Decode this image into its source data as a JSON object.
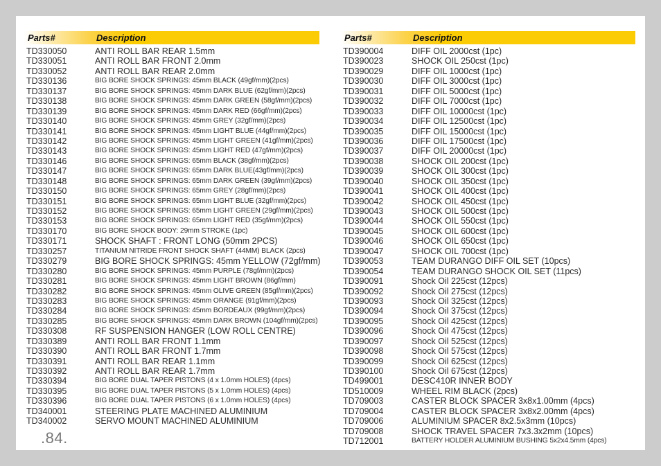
{
  "page_number": ".84.",
  "colors": {
    "header_accent": "#fbcb04",
    "background": "#cbcccb",
    "page": "#ffffff"
  },
  "left": {
    "header": {
      "parts": "Parts#",
      "description": "Description"
    },
    "rows": [
      {
        "part": "TD330050",
        "desc": "ANTI ROLL BAR REAR 1.5mm",
        "small": false
      },
      {
        "part": "TD330051",
        "desc": "ANTI ROLL BAR FRONT 2.0mm",
        "small": false
      },
      {
        "part": "TD330052",
        "desc": "ANTI ROLL BAR REAR 2.0mm",
        "small": false
      },
      {
        "part": "TD330136",
        "desc": "BIG BORE SHOCK SPRINGS: 45mm BLACK (49gf/mm)(2pcs)",
        "small": true
      },
      {
        "part": "TD330137",
        "desc": "BIG BORE SHOCK SPRINGS: 45mm DARK BLUE (62gf/mm)(2pcs)",
        "small": true
      },
      {
        "part": "TD330138",
        "desc": "BIG BORE SHOCK SPRINGS: 45mm DARK GREEN (58gf/mm)(2pcs)",
        "small": true
      },
      {
        "part": "TD330139",
        "desc": "BIG BORE SHOCK SPRINGS: 45mm DARK RED (66gf/mm)(2pcs)",
        "small": true
      },
      {
        "part": "TD330140",
        "desc": "BIG BORE SHOCK SPRINGS: 45mm GREY (32gf/mm)(2pcs)",
        "small": true
      },
      {
        "part": "TD330141",
        "desc": "BIG BORE SHOCK SPRINGS: 45mm LIGHT BLUE (44gf/mm)(2pcs)",
        "small": true
      },
      {
        "part": "TD330142",
        "desc": "BIG BORE SHOCK SPRINGS: 45mm LIGHT GREEN (41gf/mm)(2pcs)",
        "small": true
      },
      {
        "part": "TD330143",
        "desc": "BIG BORE SHOCK SPRINGS: 45mm LIGHT RED (47gf/mm)(2pcs)",
        "small": true
      },
      {
        "part": "TD330146",
        "desc": "BIG BORE SHOCK SPRINGS: 65mm BLACK (38gf/mm)(2pcs)",
        "small": true
      },
      {
        "part": "TD330147",
        "desc": "BIG  BORE SHOCK SPRINGS: 65mm DARK BLUE(43gf/mm)(2pcs)",
        "small": true
      },
      {
        "part": "TD330148",
        "desc": "BIG BORE SHOCK SPRINGS: 65mm DARK GREEN (39gf/mm)(2pcs)",
        "small": true
      },
      {
        "part": "TD330150",
        "desc": "BIG BORE SHOCK SPRINGS: 65mm GREY (28gf/mm)(2pcs)",
        "small": true
      },
      {
        "part": "TD330151",
        "desc": "BIG BORE SHOCK SPRINGS: 65mm LIGHT BLUE (32gf/mm)(2pcs)",
        "small": true
      },
      {
        "part": "TD330152",
        "desc": "BIG BORE SHOCK SPRINGS: 65mm LIGHT GREEN (29gf/mm)(2pcs)",
        "small": true
      },
      {
        "part": "TD330153",
        "desc": "BIG BORE SHOCK SPRINGS: 65mm LIGHT RED (35gf/mm)(2pcs)",
        "small": true
      },
      {
        "part": "TD330170",
        "desc": "BIG BORE SHOCK BODY: 29mm STROKE (1pc)",
        "small": true
      },
      {
        "part": "TD330171",
        "desc": "SHOCK SHAFT : FRONT LONG (50mm 2PCS)",
        "small": false
      },
      {
        "part": "TD330257",
        "desc": "TITANIUM NITRIDE FRONT SHOCK SHAFT (44MM) BLACK (2pcs)",
        "small": true
      },
      {
        "part": "TD330279",
        "desc": "BIG BORE SHOCK SPRINGS: 45mm YELLOW (72gf/mm)",
        "small": false
      },
      {
        "part": "TD330280",
        "desc": "BIG BORE SHOCK SPRINGS: 45mm PURPLE (78gf/mm)(2pcs)",
        "small": true
      },
      {
        "part": "TD330281",
        "desc": "BIG BORE SHOCK SPRINGS: 45mm LIGHT BROWN (86gf/mm)",
        "small": true
      },
      {
        "part": "TD330282",
        "desc": "BIG BORE SHOCK SPRINGS: 45mm OLIVE GREEN (85gf/mm)(2pcs)",
        "small": true
      },
      {
        "part": "TD330283",
        "desc": "BIG BORE  SHOCK SPRINGS: 45mm ORANGE (91gf/mm)(2pcs)",
        "small": true
      },
      {
        "part": "TD330284",
        "desc": "BIG BORE SHOCK SPRINGS: 45mm BORDEAUX (99gf/mm)(2pcs)",
        "small": true
      },
      {
        "part": "TD330285",
        "desc": "BIG BORE SHOCK SPRINGS: 45mm DARK BROWN (104gf/mm)(2pcs)",
        "small": true
      },
      {
        "part": "TD330308",
        "desc": "RF SUSPENSION HANGER (LOW ROLL CENTRE)",
        "small": false
      },
      {
        "part": "TD330389",
        "desc": "ANTI ROLL BAR FRONT 1.1mm",
        "small": false
      },
      {
        "part": "TD330390",
        "desc": "ANTI ROLL BAR FRONT 1.7mm",
        "small": false
      },
      {
        "part": "TD330391",
        "desc": "ANTI ROLL BAR REAR 1.1mm",
        "small": false
      },
      {
        "part": "TD330392",
        "desc": "ANTI ROLL BAR REAR 1.7mm",
        "small": false
      },
      {
        "part": "TD330394",
        "desc": "BIG BORE DUAL TAPER PISTONS (4 x 1.0mm HOLES) (4pcs)",
        "small": true
      },
      {
        "part": "TD330395",
        "desc": "BIG BORE DUAL TAPER PISTONS (5 x 1.0mm HOLES) (4pcs)",
        "small": true
      },
      {
        "part": "TD330396",
        "desc": "BIG BORE DUAL TAPER PISTONS (6 x 1.0mm HOLES) (4pcs)",
        "small": true
      },
      {
        "part": "TD340001",
        "desc": "STEERING PLATE MACHINED ALUMINIUM",
        "small": false
      },
      {
        "part": "TD340002",
        "desc": "SERVO MOUNT MACHINED ALUMINIUM",
        "small": false
      }
    ]
  },
  "right": {
    "header": {
      "parts": "Parts#",
      "description": "Description"
    },
    "rows": [
      {
        "part": "TD390004",
        "desc": "DIFF OIL 2000cst (1pc)",
        "small": false
      },
      {
        "part": "TD390023",
        "desc": "SHOCK OIL 250cst (1pc)",
        "small": false
      },
      {
        "part": "TD390029",
        "desc": "DIFF OIL 1000cst (1pc)",
        "small": false
      },
      {
        "part": "TD390030",
        "desc": "DIFF OIL 3000cst (1pc)",
        "small": false
      },
      {
        "part": "TD390031",
        "desc": "DIFF OIL 5000cst (1pc)",
        "small": false
      },
      {
        "part": "TD390032",
        "desc": "DIFF OIL 7000cst (1pc)",
        "small": false
      },
      {
        "part": "TD390033",
        "desc": "DIFF OIL 10000cst (1pc)",
        "small": false
      },
      {
        "part": "TD390034",
        "desc": "DIFF OIL 12500cst (1pc)",
        "small": false
      },
      {
        "part": "TD390035",
        "desc": "DIFF OIL 15000cst (1pc)",
        "small": false
      },
      {
        "part": "TD390036",
        "desc": "DIFF OIL 17500cst (1pc)",
        "small": false
      },
      {
        "part": "TD390037",
        "desc": "DIFF OIL 20000cst (1pc)",
        "small": false
      },
      {
        "part": "TD390038",
        "desc": "SHOCK OIL 200cst (1pc)",
        "small": false
      },
      {
        "part": "TD390039",
        "desc": "SHOCK OIL 300cst (1pc)",
        "small": false
      },
      {
        "part": "TD390040",
        "desc": "SHOCK OIL 350cst (1pc)",
        "small": false
      },
      {
        "part": "TD390041",
        "desc": "SHOCK OIL 400cst (1pc)",
        "small": false
      },
      {
        "part": "TD390042",
        "desc": "SHOCK OIL 450cst (1pc)",
        "small": false
      },
      {
        "part": "TD390043",
        "desc": "SHOCK OIL 500cst (1pc)",
        "small": false
      },
      {
        "part": "TD390044",
        "desc": "SHOCK OIL 550cst (1pc)",
        "small": false
      },
      {
        "part": "TD390045",
        "desc": "SHOCK OIL 600cst (1pc)",
        "small": false
      },
      {
        "part": "TD390046",
        "desc": "SHOCK OIL 650cst (1pc)",
        "small": false
      },
      {
        "part": "TD390047",
        "desc": "SHOCK OIL 700cst (1pc)",
        "small": false
      },
      {
        "part": "TD390053",
        "desc": "TEAM DURANGO DIFF OIL SET (10pcs)",
        "small": false
      },
      {
        "part": "TD390054",
        "desc": "TEAM DURANGO SHOCK OIL SET (11pcs)",
        "small": false
      },
      {
        "part": "TD390091",
        "desc": "Shock Oil 225cst (12pcs)",
        "small": false
      },
      {
        "part": "TD390092",
        "desc": "Shock Oil 275cst (12pcs)",
        "small": false
      },
      {
        "part": "TD390093",
        "desc": "Shock Oil 325cst (12pcs)",
        "small": false
      },
      {
        "part": "TD390094",
        "desc": "Shock Oil 375cst (12pcs)",
        "small": false
      },
      {
        "part": "TD390095",
        "desc": "Shock Oil 425cst (12pcs)",
        "small": false
      },
      {
        "part": "TD390096",
        "desc": "Shock Oil 475cst (12pcs)",
        "small": false
      },
      {
        "part": "TD390097",
        "desc": "Shock Oil 525cst (12pcs)",
        "small": false
      },
      {
        "part": "TD390098",
        "desc": "Shock Oil 575cst (12pcs)",
        "small": false
      },
      {
        "part": "TD390099",
        "desc": "Shock Oil 625cst (12pcs)",
        "small": false
      },
      {
        "part": "TD390100",
        "desc": "Shock Oil 675cst (12pcs)",
        "small": false
      },
      {
        "part": "TD499001",
        "desc": "DESC410R INNER BODY",
        "small": false
      },
      {
        "part": "TD510009",
        "desc": "WHEEL RIM BLACK (2pcs)",
        "small": false
      },
      {
        "part": "TD709003",
        "desc": "CASTER BLOCK SPACER 3x8x1.00mm (4pcs)",
        "small": false
      },
      {
        "part": "TD709004",
        "desc": "CASTER BLOCK SPACER 3x8x2.00mm (4pcs)",
        "small": false
      },
      {
        "part": "TD709006",
        "desc": "ALUMINIUM SPACER 8x2.5x3mm (10pcs)",
        "small": false
      },
      {
        "part": "TD709008",
        "desc": "SHOCK TRAVEL SPACER 7x3.3x2mm (10pcs)",
        "small": false
      },
      {
        "part": "TD712001",
        "desc": "BATTERY HOLDER ALUMINIUM BUSHING 5x2x4.5mm (4pcs)",
        "small": true
      }
    ]
  }
}
